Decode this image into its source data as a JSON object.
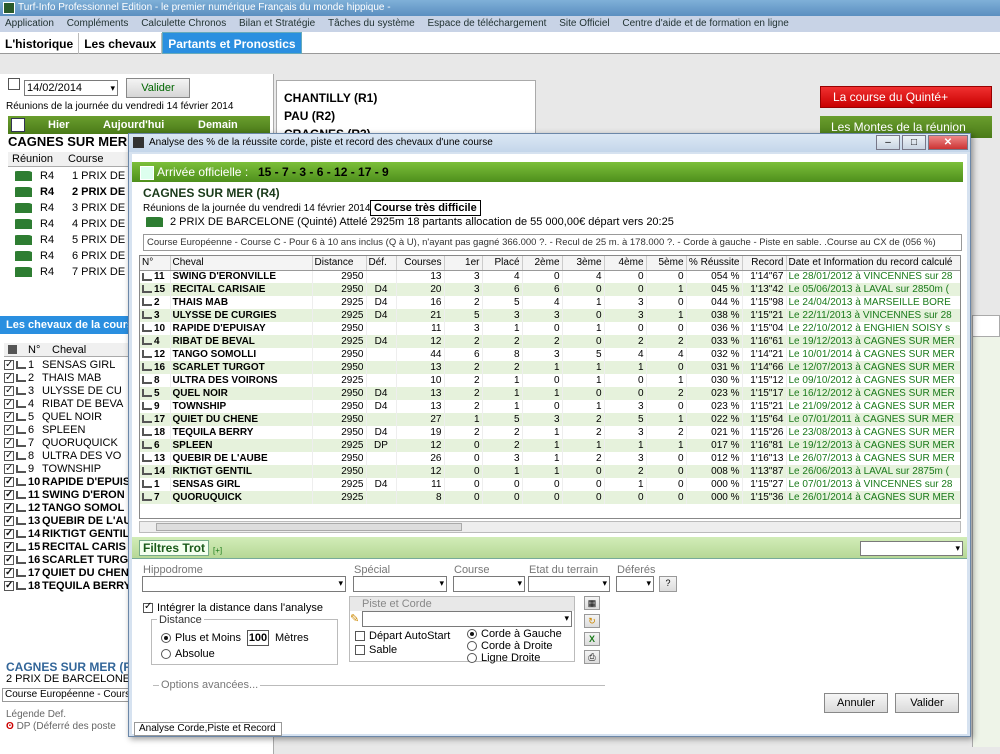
{
  "app": {
    "title": "Turf-Info Professionnel Edition - le premier numérique Français du monde hippique -",
    "menu": [
      "Application",
      "Compléments",
      "Calculette Chronos",
      "Bilan et Stratégie",
      "Tâches du système",
      "Espace de téléchargement",
      "Site Officiel",
      "Centre d'aide et de formation en ligne"
    ],
    "tabs": [
      "L'historique",
      "Les chevaux",
      "Partants et Pronostics"
    ]
  },
  "left": {
    "date": "14/02/2014",
    "valider": "Valider",
    "reunions_label": "Réunions de la journée du vendredi 14 février 2014",
    "nav": {
      "hier": "Hier",
      "aujourdhui": "Aujourd'hui",
      "demain": "Demain"
    },
    "race_title": "CAGNES SUR MER",
    "col_reunion": "Réunion",
    "col_course": "Course",
    "races": [
      {
        "r": "R4",
        "course": "1 PRIX DE P"
      },
      {
        "r": "R4",
        "course": "2 PRIX DE B"
      },
      {
        "r": "R4",
        "course": "3 PRIX DE S"
      },
      {
        "r": "R4",
        "course": "4 PRIX DE G"
      },
      {
        "r": "R4",
        "course": "5 PRIX DE JE"
      },
      {
        "r": "R4",
        "course": "6 PRIX DE M"
      },
      {
        "r": "R4",
        "course": "7 PRIX DE M"
      }
    ],
    "chevaux_bar": "Les chevaux de la cours",
    "col_num": "N°",
    "col_cheval": "Cheval",
    "horses": [
      {
        "n": "1",
        "name": "SENSAS GIRL"
      },
      {
        "n": "2",
        "name": "THAIS MAB"
      },
      {
        "n": "3",
        "name": "ULYSSE DE CU"
      },
      {
        "n": "4",
        "name": "RIBAT DE BEVA"
      },
      {
        "n": "5",
        "name": "QUEL NOIR"
      },
      {
        "n": "6",
        "name": "SPLEEN"
      },
      {
        "n": "7",
        "name": "QUORUQUICK"
      },
      {
        "n": "8",
        "name": "ULTRA DES VO"
      },
      {
        "n": "9",
        "name": "TOWNSHIP"
      },
      {
        "n": "10",
        "name": "RAPIDE D'EPUIS"
      },
      {
        "n": "11",
        "name": "SWING D'ERON"
      },
      {
        "n": "12",
        "name": "TANGO SOMOL"
      },
      {
        "n": "13",
        "name": "QUEBIR DE L'AU"
      },
      {
        "n": "14",
        "name": "RIKTIGT GENTIL"
      },
      {
        "n": "15",
        "name": "RECITAL CARIS"
      },
      {
        "n": "16",
        "name": "SCARLET TURG"
      },
      {
        "n": "17",
        "name": "QUIET DU CHEN"
      },
      {
        "n": "18",
        "name": "TEQUILA BERRY"
      }
    ],
    "bottom_title": "CAGNES SUR MER (R4)",
    "bottom_race": "2 PRIX DE BARCELONE (",
    "bottom_desc": "Course Européenne - Cours",
    "legend": "Légende Def.",
    "legend_dp": "DP (Déferré des poste"
  },
  "center": {
    "reunions": [
      "CHANTILLY (R1)",
      "PAU (R2)",
      "CRAGNES (R3)"
    ]
  },
  "right": {
    "quinte": "La course du Quinté+",
    "montes": "Les Montes de la réunion"
  },
  "dialog": {
    "title": "Analyse des % de la réussite corde, piste et record des chevaux d'une course",
    "arrivee_label": "Arrivée officielle :",
    "arrivee": "15 - 7 - 3 - 6 - 12 - 17 - 9",
    "race_title": "CAGNES SUR MER (R4)",
    "date_line": "Réunions de la journée du vendredi 14 février 2014",
    "difficulty": "Course très difficile",
    "race_line": "2 PRIX DE BARCELONE (Quinté) Attelé 2925m 18 partants allocation de 55 000,00€ départ vers 20:25",
    "desc": "Course Européenne - Course C - Pour 6 à 10 ans inclus (Q à U), n'ayant pas gagné 366.000 ?. - Recul de 25 m. à 178.000 ?. - Corde à gauche - Piste en sable. .Course au CX de (056 %)",
    "columns": [
      "N°",
      "Cheval",
      "Distance",
      "Déf.",
      "Courses",
      "1er",
      "Placé",
      "2ème",
      "3ème",
      "4ème",
      "5ème",
      "% Réussite",
      "Record",
      "Date et Information du record calculé"
    ],
    "rows": [
      [
        "11",
        "SWING D'ERONVILLE",
        "2950",
        "",
        "13",
        "3",
        "4",
        "0",
        "4",
        "0",
        "0",
        "054 %",
        "1'14\"67",
        "Le 28/01/2012 à VINCENNES sur 28"
      ],
      [
        "15",
        "RECITAL CARISAIE",
        "2950",
        "D4",
        "20",
        "3",
        "6",
        "6",
        "0",
        "0",
        "1",
        "045 %",
        "1'13\"42",
        "Le 05/06/2013 à LAVAL sur 2850m ("
      ],
      [
        "2",
        "THAIS MAB",
        "2925",
        "D4",
        "16",
        "2",
        "5",
        "4",
        "1",
        "3",
        "0",
        "044 %",
        "1'15\"98",
        "Le 24/04/2013 à MARSEILLE BORE"
      ],
      [
        "3",
        "ULYSSE DE CURGIES",
        "2925",
        "D4",
        "21",
        "5",
        "3",
        "3",
        "0",
        "3",
        "1",
        "038 %",
        "1'15\"21",
        "Le 22/11/2013 à VINCENNES sur 28"
      ],
      [
        "10",
        "RAPIDE D'EPUISAY",
        "2950",
        "",
        "11",
        "3",
        "1",
        "0",
        "1",
        "0",
        "0",
        "036 %",
        "1'15\"04",
        "Le 22/10/2012 à ENGHIEN SOISY s"
      ],
      [
        "4",
        "RIBAT DE BEVAL",
        "2925",
        "D4",
        "12",
        "2",
        "2",
        "2",
        "0",
        "2",
        "2",
        "033 %",
        "1'16\"61",
        "Le 19/12/2013 à CAGNES SUR MER"
      ],
      [
        "12",
        "TANGO SOMOLLI",
        "2950",
        "",
        "44",
        "6",
        "8",
        "3",
        "5",
        "4",
        "4",
        "032 %",
        "1'14\"21",
        "Le 10/01/2014 à CAGNES SUR MER"
      ],
      [
        "16",
        "SCARLET TURGOT",
        "2950",
        "",
        "13",
        "2",
        "2",
        "1",
        "1",
        "1",
        "0",
        "031 %",
        "1'14\"66",
        "Le 12/07/2013 à CAGNES SUR MER"
      ],
      [
        "8",
        "ULTRA DES VOIRONS",
        "2925",
        "",
        "10",
        "2",
        "1",
        "0",
        "1",
        "0",
        "1",
        "030 %",
        "1'15\"12",
        "Le 09/10/2012 à CAGNES SUR MER"
      ],
      [
        "5",
        "QUEL NOIR",
        "2950",
        "D4",
        "13",
        "2",
        "1",
        "1",
        "0",
        "0",
        "2",
        "023 %",
        "1'15\"17",
        "Le 16/12/2012 à CAGNES SUR MER"
      ],
      [
        "9",
        "TOWNSHIP",
        "2950",
        "D4",
        "13",
        "2",
        "1",
        "0",
        "1",
        "3",
        "0",
        "023 %",
        "1'15\"21",
        "Le 21/09/2012 à CAGNES SUR MER"
      ],
      [
        "17",
        "QUIET DU CHENE",
        "2950",
        "",
        "27",
        "1",
        "5",
        "3",
        "2",
        "5",
        "1",
        "022 %",
        "1'15\"64",
        "Le 07/01/2011 à CAGNES SUR MER"
      ],
      [
        "18",
        "TEQUILA BERRY",
        "2950",
        "D4",
        "19",
        "2",
        "2",
        "1",
        "2",
        "3",
        "2",
        "021 %",
        "1'15\"26",
        "Le 23/08/2013 à CAGNES SUR MER"
      ],
      [
        "6",
        "SPLEEN",
        "2925",
        "DP",
        "12",
        "0",
        "2",
        "1",
        "1",
        "1",
        "1",
        "017 %",
        "1'16\"81",
        "Le 19/12/2013 à CAGNES SUR MER"
      ],
      [
        "13",
        "QUEBIR DE L'AUBE",
        "2950",
        "",
        "26",
        "0",
        "3",
        "1",
        "2",
        "3",
        "0",
        "012 %",
        "1'16\"13",
        "Le 26/07/2013 à CAGNES SUR MER"
      ],
      [
        "14",
        "RIKTIGT GENTIL",
        "2950",
        "",
        "12",
        "0",
        "1",
        "1",
        "0",
        "2",
        "0",
        "008 %",
        "1'13\"87",
        "Le 26/06/2013 à LAVAL sur 2875m ("
      ],
      [
        "1",
        "SENSAS GIRL",
        "2925",
        "D4",
        "11",
        "0",
        "0",
        "0",
        "0",
        "1",
        "0",
        "000 %",
        "1'15\"27",
        "Le 07/01/2013 à VINCENNES sur 28"
      ],
      [
        "7",
        "QUORUQUICK",
        "2925",
        "",
        "8",
        "0",
        "0",
        "0",
        "0",
        "0",
        "0",
        "000 %",
        "1'15\"36",
        "Le 26/01/2014 à CAGNES SUR MER"
      ]
    ],
    "filtres": "Filtres Trot",
    "filtres_plus": "[+]",
    "labels": {
      "hippodrome": "Hippodrome",
      "special": "Spécial",
      "course": "Course",
      "etat": "Etat du terrain",
      "deferes": "Déferés",
      "integrer": "Intégrer la distance dans l'analyse",
      "distance": "Distance",
      "plus_moins": "Plus et Moins",
      "metres_value": "100",
      "metres": "Mètres",
      "absolue": "Absolue",
      "piste_corde": "Piste et Corde",
      "depart_auto": "Départ AutoStart",
      "sable": "Sable",
      "corde_g": "Corde à Gauche",
      "corde_d": "Corde à Droite",
      "ligne_d": "Ligne Droite",
      "options": "Options avancées..."
    },
    "annuler": "Annuler",
    "valider": "Valider",
    "status_tab": "Analyse Corde,Piste et Record"
  }
}
